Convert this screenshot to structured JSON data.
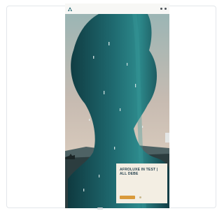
{
  "header": {
    "brand": "",
    "icons": [
      "logo-icon",
      "search-icon",
      "menu-icon"
    ]
  },
  "hero": {
    "image": "silhouette-of-woman-profile-double-exposure"
  },
  "panel": {
    "title": "AFROLUXE IN TEST | ALL DEBE",
    "subtitle": "",
    "button_label": ""
  },
  "colors": {
    "accent": "#d99a3b",
    "panel_bg": "#f3eee3",
    "teal": "#1f5f63",
    "sky": "#cdbfb2"
  }
}
